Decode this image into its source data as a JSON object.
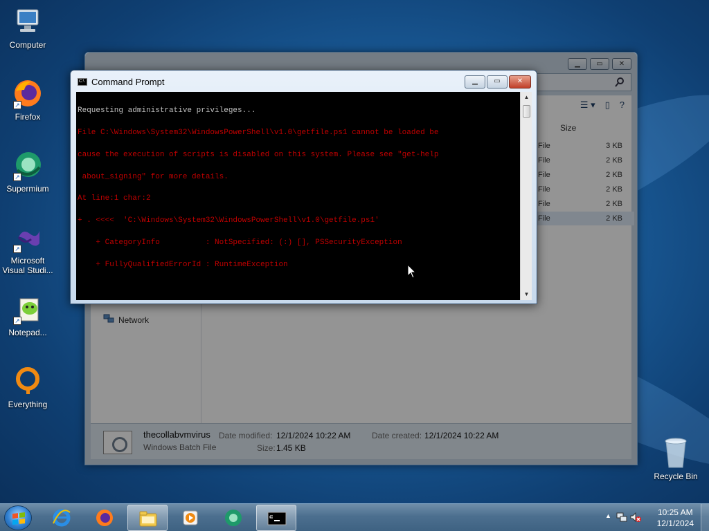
{
  "desktop": {
    "icons": [
      {
        "name": "computer",
        "label": "Computer"
      },
      {
        "name": "firefox",
        "label": "Firefox"
      },
      {
        "name": "supermium",
        "label": "Supermium"
      },
      {
        "name": "visual-studio",
        "label": "Microsoft Visual Studi..."
      },
      {
        "name": "notepad",
        "label": "Notepad..."
      },
      {
        "name": "everything",
        "label": "Everything"
      }
    ],
    "recycle_bin": "Recycle Bin"
  },
  "explorer": {
    "column_size": "Size",
    "rows": [
      {
        "type": "File",
        "size": "3 KB"
      },
      {
        "type": "File",
        "size": "2 KB"
      },
      {
        "type": "File",
        "size": "2 KB"
      },
      {
        "type": "File",
        "size": "2 KB"
      },
      {
        "type": "File",
        "size": "2 KB"
      },
      {
        "type": "File",
        "size": "2 KB"
      }
    ],
    "nav_network": "Network",
    "details": {
      "file_name": "thecollabvmvirus",
      "file_type": "Windows Batch File",
      "date_modified_label": "Date modified:",
      "date_modified": "12/1/2024 10:22 AM",
      "date_created_label": "Date created:",
      "date_created": "12/1/2024 10:22 AM",
      "size_label": "Size:",
      "size": "1.45 KB"
    }
  },
  "cmd": {
    "title": "Command Prompt",
    "lines": [
      {
        "text": "Requesting administrative privileges...",
        "kind": "normal"
      },
      {
        "text": "File C:\\Windows\\System32\\WindowsPowerShell\\v1.0\\getfile.ps1 cannot be loaded be",
        "kind": "error"
      },
      {
        "text": "cause the execution of scripts is disabled on this system. Please see \"get-help",
        "kind": "error"
      },
      {
        "text": " about_signing\" for more details.",
        "kind": "error"
      },
      {
        "text": "At line:1 char:2",
        "kind": "error"
      },
      {
        "text": "+ . <<<<  'C:\\Windows\\System32\\WindowsPowerShell\\v1.0\\getfile.ps1'",
        "kind": "error"
      },
      {
        "text": "    + CategoryInfo          : NotSpecified: (:) [], PSSecurityException",
        "kind": "error"
      },
      {
        "text": "    + FullyQualifiedErrorId : RuntimeException",
        "kind": "error"
      }
    ]
  },
  "taskbar": {
    "items": [
      "start",
      "internet-explorer",
      "firefox",
      "windows-explorer",
      "media-player",
      "supermium",
      "command-prompt"
    ],
    "clock_time": "10:25 AM",
    "clock_date": "12/1/2024"
  }
}
